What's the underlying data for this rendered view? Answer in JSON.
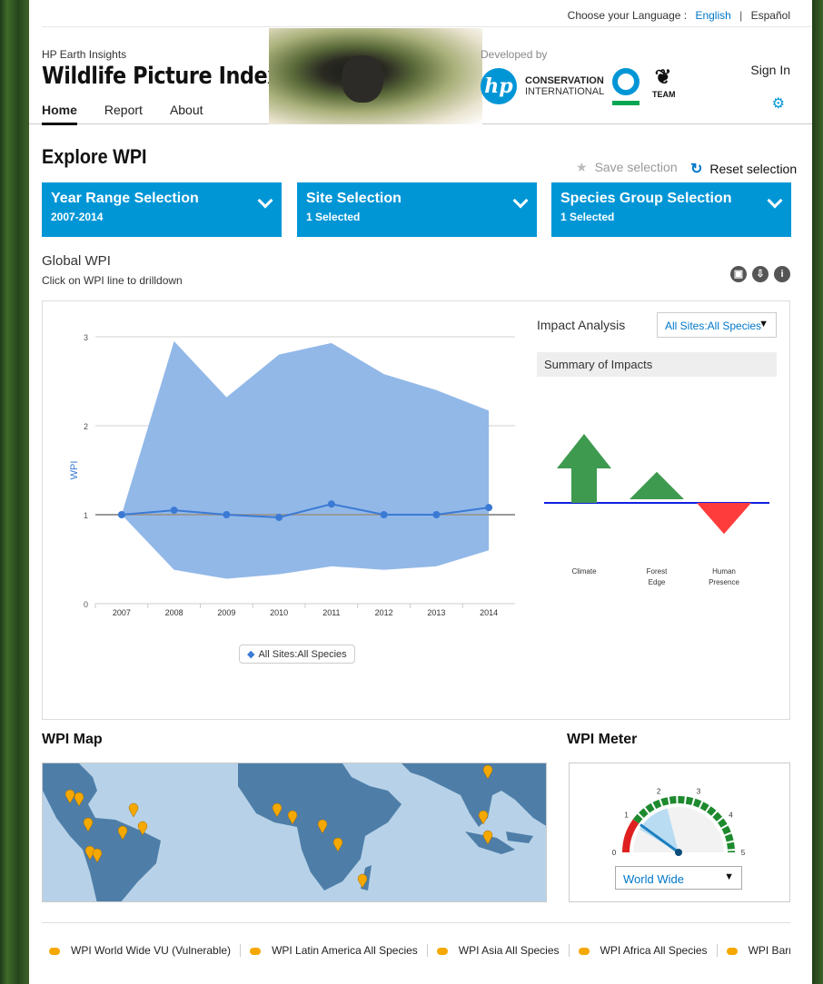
{
  "topbar": {
    "choose_label": "Choose your Language :",
    "lang_en": "English",
    "separator": "|",
    "lang_es": "Español"
  },
  "header": {
    "subtitle": "HP Earth Insights",
    "title": "Wildlife Picture Index",
    "nav": [
      "Home",
      "Report",
      "About"
    ],
    "developed_by": "Developed by",
    "hp_logo_text": "hp",
    "ci_line1": "CONSERVATION",
    "ci_line2": "INTERNATIONAL",
    "team_label": "TEAM",
    "sign_in": "Sign In",
    "settings_icon": "gear-icon"
  },
  "explore": {
    "title": "Explore WPI",
    "save_selection": "Save selection",
    "reset_selection": "Reset selection"
  },
  "filters": [
    {
      "title": "Year Range Selection",
      "value": "2007-2014"
    },
    {
      "title": "Site Selection",
      "value": "1 Selected"
    },
    {
      "title": "Species Group Selection",
      "value": "1 Selected"
    }
  ],
  "global": {
    "title": "Global WPI",
    "subtitle": "Click on WPI line to drilldown"
  },
  "chart_data": {
    "type": "line",
    "x": [
      "2007",
      "2008",
      "2009",
      "2010",
      "2011",
      "2012",
      "2013",
      "2014"
    ],
    "series": [
      {
        "name": "All Sites:All Species",
        "values": [
          1.0,
          1.05,
          1.0,
          0.97,
          1.12,
          1.0,
          1.0,
          1.08
        ]
      }
    ],
    "band_upper": [
      1.0,
      2.95,
      2.32,
      2.8,
      2.93,
      2.58,
      2.4,
      2.17
    ],
    "band_lower": [
      1.0,
      0.38,
      0.28,
      0.33,
      0.42,
      0.38,
      0.42,
      0.6
    ],
    "ylabel": "WPI",
    "yticks": [
      "0",
      "1",
      "2",
      "3"
    ],
    "ylim": [
      0,
      3
    ],
    "grid": true,
    "legend": "bottom-center",
    "colors": {
      "line": "#3b7ad4",
      "band": "#92b8e8"
    }
  },
  "impact": {
    "title": "Impact Analysis",
    "select_value": "All Sites:All Species",
    "summary_label": "Summary of Impacts",
    "items": [
      {
        "label": "Climate",
        "direction": "up",
        "magnitude": 1.0,
        "color": "#3e9a4f"
      },
      {
        "label": "Forest Edge",
        "direction": "up",
        "magnitude": 0.45,
        "color": "#3e9a4f"
      },
      {
        "label": "Human Presence",
        "direction": "down",
        "magnitude": 0.45,
        "color": "#ff3c3c"
      }
    ]
  },
  "map": {
    "title": "WPI Map"
  },
  "meter": {
    "title": "WPI Meter",
    "ticks": [
      "0",
      "1",
      "2",
      "3",
      "4",
      "5"
    ],
    "value": 1.0,
    "select_value": "World Wide"
  },
  "legend_row": [
    "WPI World Wide VU (Vulnerable)",
    "WPI Latin America All Species",
    "WPI Asia All Species",
    "WPI Africa All Species",
    "WPI Barro Colorado Nat"
  ]
}
